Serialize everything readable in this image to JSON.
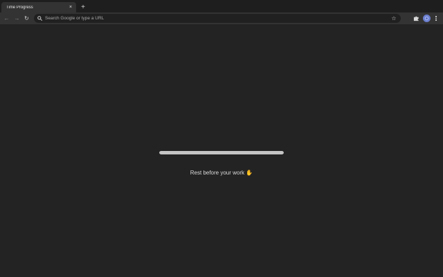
{
  "browser": {
    "tab": {
      "title": "Time Progress",
      "close_glyph": "×"
    },
    "new_tab_glyph": "+",
    "nav": {
      "back_glyph": "←",
      "forward_glyph": "→",
      "reload_glyph": "↻"
    },
    "omnibox": {
      "value": "",
      "placeholder": "Search Google or type a URL",
      "star_glyph": "☆"
    },
    "icons": {
      "search": "search-icon",
      "extensions": "puzzle-icon",
      "avatar": "profile-avatar",
      "menu": "kebab-menu-icon"
    }
  },
  "page": {
    "progress": {
      "fraction": 1.0
    },
    "message": {
      "text": "Rest before your work",
      "emoji": "✋"
    }
  },
  "colors": {
    "background": "#232323",
    "toolbar": "#333333",
    "tabstrip": "#1e1e1e",
    "progress_fill": "#c4c4c4",
    "avatar": "#6b7fcf"
  }
}
